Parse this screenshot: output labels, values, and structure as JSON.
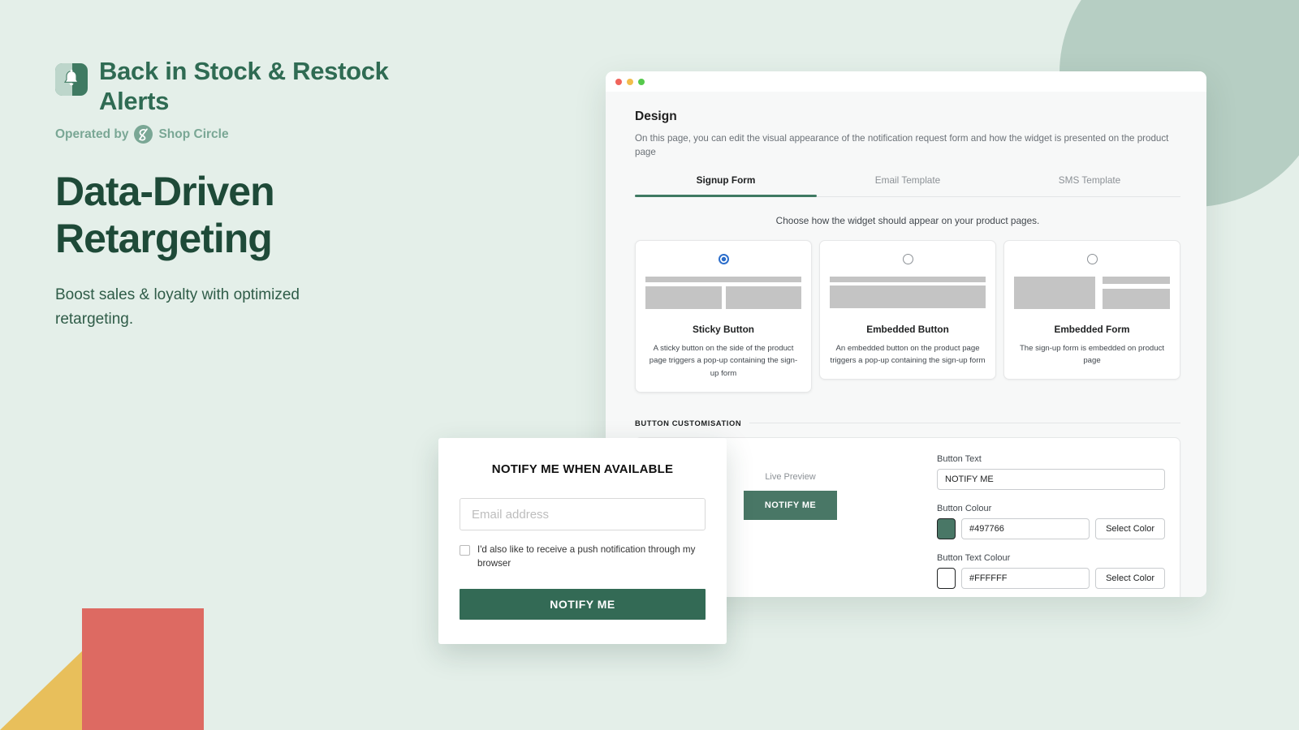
{
  "brand": {
    "app_name": "Back in Stock & Restock Alerts",
    "logo_icon": "bell-icon",
    "operated_by_label": "Operated by",
    "partner_name": "Shop Circle",
    "partner_logo_icon": "shop-circle-icon"
  },
  "hero": {
    "headline": "Data-Driven Retargeting",
    "subheadline": "Boost sales & loyalty with optimized retargeting."
  },
  "window": {
    "traffic_lights": [
      "close-dot",
      "minimize-dot",
      "maximize-dot"
    ],
    "page_title": "Design",
    "page_description": "On this page, you can edit the visual appearance of the notification request form and how the widget is presented on the product page",
    "tabs": [
      {
        "label": "Signup Form",
        "active": true
      },
      {
        "label": "Email Template",
        "active": false
      },
      {
        "label": "SMS Template",
        "active": false
      }
    ],
    "choose_line": "Choose how the widget should appear on your product pages.",
    "option_cards": [
      {
        "name": "Sticky Button",
        "description": "A sticky button on the side of the product page triggers a pop-up containing the sign-up form",
        "selected": true
      },
      {
        "name": "Embedded Button",
        "description": "An embedded button on the product page triggers a pop-up containing the sign-up form",
        "selected": false
      },
      {
        "name": "Embedded Form",
        "description": "The sign-up form is embedded on product page",
        "selected": false
      }
    ],
    "button_customisation": {
      "section_label": "BUTTON CUSTOMISATION",
      "live_preview_label": "Live Preview",
      "preview_button_label": "NOTIFY ME",
      "fields": [
        {
          "label": "Button Text",
          "value": "NOTIFY ME",
          "has_swatch": false,
          "has_select_color": false
        },
        {
          "label": "Button Colour",
          "value": "#497766",
          "has_swatch": true,
          "swatch_color": "#497766",
          "has_select_color": true,
          "select_color_label": "Select Color"
        },
        {
          "label": "Button Text Colour",
          "value": "#FFFFFF",
          "has_swatch": true,
          "swatch_color": "#FFFFFF",
          "has_select_color": true,
          "select_color_label": "Select Color"
        }
      ]
    }
  },
  "modal": {
    "title": "NOTIFY ME WHEN AVAILABLE",
    "email_placeholder": "Email address",
    "email_value": "",
    "checkbox_label": "I'd also like to receive a push notification through my browser",
    "checkbox_checked": false,
    "submit_label": "NOTIFY ME"
  },
  "colors": {
    "page_background": "#e4efe9",
    "brand_green": "#2f6b53",
    "headline_green": "#1e4a38",
    "accent_green": "#497766",
    "modal_button_green": "#336a55",
    "tab_underline": "#3f7a62",
    "radio_blue": "#2c6ecb",
    "deco_circle": "#b6cec3",
    "deco_triangle": "#e8bf5b",
    "deco_quarter": "#dd6a62"
  }
}
